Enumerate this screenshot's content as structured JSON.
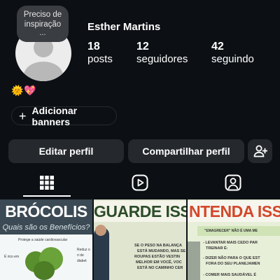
{
  "profile": {
    "note": "Preciso de inspiração",
    "note_more": "...",
    "username": "Esther Martins",
    "bio_emoji": "🌞💖",
    "stats": [
      {
        "value": "18",
        "label": "posts"
      },
      {
        "value": "12",
        "label": "seguidores"
      },
      {
        "value": "42",
        "label": "seguindo"
      }
    ]
  },
  "actions": {
    "add_banners": "Adicionar banners",
    "edit_profile": "Editar perfil",
    "share_profile": "Compartilhar perfil"
  },
  "tabs": [
    {
      "icon": "grid-icon",
      "active": true
    },
    {
      "icon": "reels-icon",
      "active": false
    },
    {
      "icon": "tagged-icon",
      "active": false
    }
  ],
  "posts": [
    {
      "title": "BRÓCOLIS",
      "subtitle": "Quais são os Benefícios?",
      "labels": [
        "Protege a saúde cardiovascular",
        "É rico em",
        "Reduz o ri de diabet"
      ]
    },
    {
      "title": "GUARDE ISSO.",
      "lines": [
        "SE O PESO NA BALANÇA",
        "ESTÁ MUDANDO, MAS SE",
        "ROUPAS ESTÃO VESTIN",
        "MELHOR EM VOCÊ, VOC",
        "ESTÁ NO CAMINHO CER"
      ]
    },
    {
      "title": "NTENDA ISSO",
      "lines": [
        "\"EMAGRECER\" NÃO É UMA ME",
        "- LEVANTAR MAIS CEDO PAR",
        "TREINAR É:",
        "- DIZER NÃO PARA O QUE EST",
        "FORA DO SEU PLANEJAMEN",
        "- COMER MAIS SAUDÁVEL É"
      ]
    }
  ],
  "colors": {
    "background": "#0c1014",
    "button": "#25292e",
    "text": "#ffffff"
  }
}
